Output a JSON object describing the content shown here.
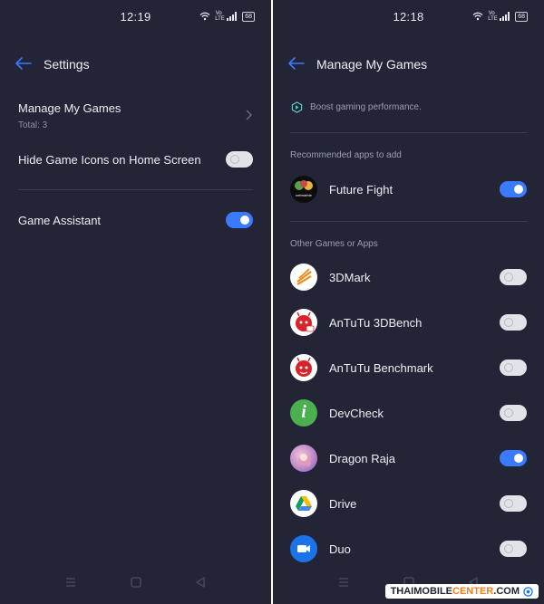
{
  "colors": {
    "background": "#232537",
    "accent": "#3a7afe",
    "text": "#eceef5",
    "muted": "#8d90a3"
  },
  "left": {
    "status": {
      "time": "12:19",
      "volte": "Vo LTE",
      "battery": "68"
    },
    "title": "Settings",
    "manage": {
      "label": "Manage My Games",
      "sub": "Total: 3"
    },
    "hide_icons": {
      "label": "Hide Game Icons on Home Screen",
      "enabled": false
    },
    "assistant": {
      "label": "Game Assistant",
      "enabled": true
    }
  },
  "right": {
    "status": {
      "time": "12:18",
      "volte": "Vo LTE",
      "battery": "68"
    },
    "title": "Manage My Games",
    "boost": "Boost gaming performance.",
    "recommended": {
      "header": "Recommended apps to add",
      "items": [
        {
          "name": "Future Fight",
          "enabled": true,
          "icon": "future-fight-icon",
          "icon_text": "netmarble"
        }
      ]
    },
    "others": {
      "header": "Other Games or Apps",
      "items": [
        {
          "name": "3DMark",
          "enabled": false,
          "icon": "3dmark-icon"
        },
        {
          "name": "AnTuTu 3DBench",
          "enabled": false,
          "icon": "antutu-3dbench-icon"
        },
        {
          "name": "AnTuTu Benchmark",
          "enabled": false,
          "icon": "antutu-benchmark-icon"
        },
        {
          "name": "DevCheck",
          "enabled": false,
          "icon": "devcheck-icon",
          "icon_text": "i"
        },
        {
          "name": "Dragon Raja",
          "enabled": true,
          "icon": "dragon-raja-icon"
        },
        {
          "name": "Drive",
          "enabled": false,
          "icon": "drive-icon"
        },
        {
          "name": "Duo",
          "enabled": false,
          "icon": "duo-icon"
        }
      ]
    }
  },
  "watermark": {
    "part1": "THAIMOBILE",
    "part2": "CENTER",
    "part3": ".COM"
  }
}
